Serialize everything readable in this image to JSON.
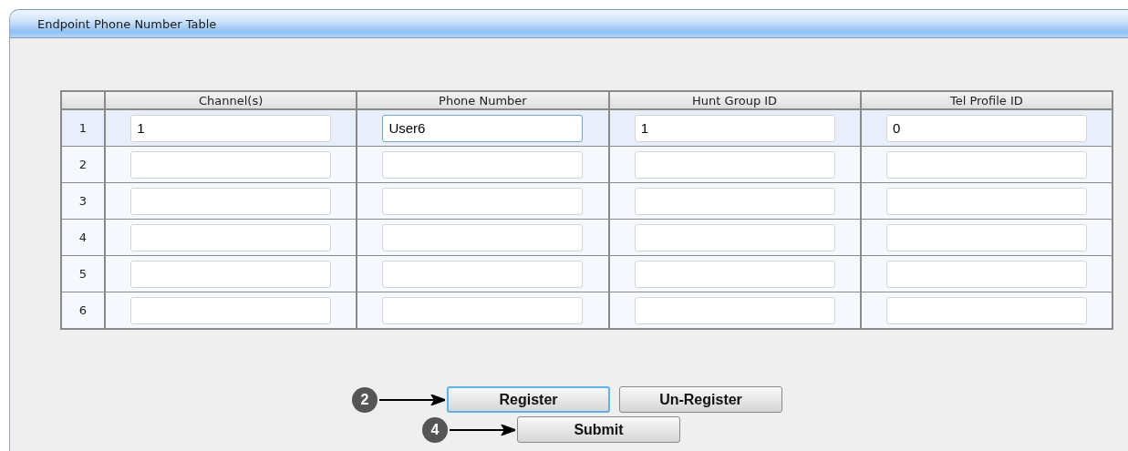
{
  "panel": {
    "title": "Endpoint Phone Number Table"
  },
  "table": {
    "columns": [
      "Channel(s)",
      "Phone Number",
      "Hunt Group ID",
      "Tel Profile ID"
    ],
    "rows": [
      {
        "index": "1",
        "cells": [
          {
            "value": "1",
            "focused": false
          },
          {
            "value": "User6",
            "focused": true
          },
          {
            "value": "1",
            "focused": false
          },
          {
            "value": "0",
            "focused": false
          }
        ]
      },
      {
        "index": "2",
        "cells": [
          {
            "focused": false
          },
          {
            "focused": false
          },
          {
            "focused": false
          },
          {
            "focused": false
          }
        ]
      },
      {
        "index": "3",
        "cells": [
          {
            "focused": false
          },
          {
            "focused": false
          },
          {
            "focused": false
          },
          {
            "focused": false
          }
        ]
      },
      {
        "index": "4",
        "cells": [
          {
            "focused": false
          },
          {
            "focused": false
          },
          {
            "focused": false
          },
          {
            "focused": false
          }
        ]
      },
      {
        "index": "5",
        "cells": [
          {
            "focused": false
          },
          {
            "focused": false
          },
          {
            "focused": false
          },
          {
            "focused": false
          }
        ]
      },
      {
        "index": "6",
        "cells": [
          {
            "focused": false
          },
          {
            "focused": false
          },
          {
            "focused": false
          },
          {
            "focused": false
          }
        ]
      }
    ]
  },
  "button_rows": [
    {
      "callout": "2",
      "buttons": [
        {
          "label": "Register",
          "focused": true
        },
        {
          "label": "Un-Register",
          "focused": false
        }
      ]
    },
    {
      "callout": "4",
      "buttons": [
        {
          "label": "Submit",
          "focused": false
        }
      ]
    }
  ]
}
